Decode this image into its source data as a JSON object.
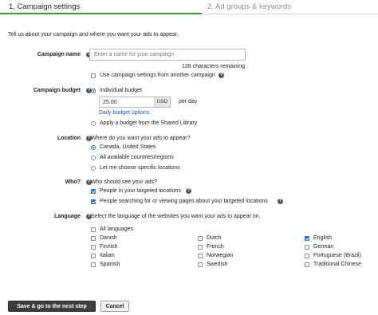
{
  "tabs": {
    "step1": "1. Campaign settings",
    "step2": "2. Ad groups & keywords"
  },
  "intro": "Tell us about your campaign and where you want your ads to appear.",
  "campaign_name": {
    "label": "Campaign name",
    "placeholder": "Enter a name for your campaign",
    "chars_remaining": "128 characters remaining",
    "use_settings": "Use campaign settings from another campaign"
  },
  "campaign_budget": {
    "label": "Campaign budget",
    "individual": "Individual budget",
    "amount": "25.00",
    "currency": "USD",
    "per_day": "per day",
    "daily_options": "Daily budget options",
    "shared": "Apply a budget from the Shared Library"
  },
  "location": {
    "label": "Location",
    "question": "Where do you want your ads to appear?",
    "options": [
      "Canada, United States",
      "All available countries/regions",
      "Let me choose specific locations"
    ]
  },
  "who": {
    "label": "Who?",
    "question": "Who should see your ads?",
    "options": [
      "People in your targeted locations",
      "People searching for or viewing pages about your targeted locations"
    ]
  },
  "language": {
    "label": "Language",
    "question": "Select the language of the websites you want your ads to appear on.",
    "all": "All languages",
    "col1": [
      "Danish",
      "Finnish",
      "Italian",
      "Spanish"
    ],
    "col2": [
      "Dutch",
      "French",
      "Norwegian",
      "Swedish"
    ],
    "col3": [
      "English",
      "German",
      "Portuguese (Brazil)",
      "Traditional Chinese"
    ]
  },
  "buttons": {
    "save": "Save & go to the next step",
    "cancel": "Cancel"
  },
  "colors": {
    "accent_green": "#3c8a3f",
    "link_blue": "#1a55c9",
    "checked_blue": "#2a6fd6"
  }
}
